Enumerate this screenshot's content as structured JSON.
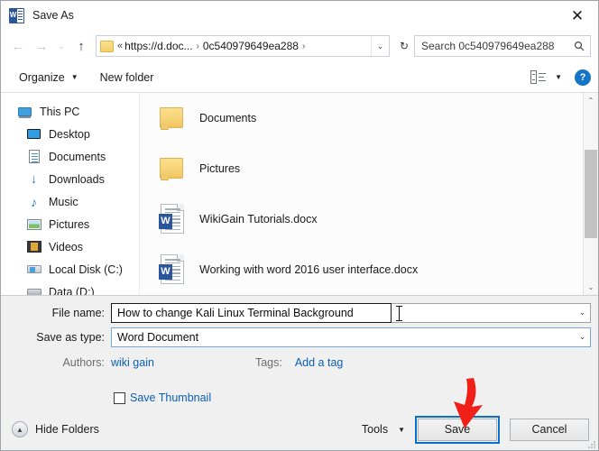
{
  "window": {
    "title": "Save As",
    "app_icon": "word-icon",
    "close_label": "✕"
  },
  "nav": {
    "back": "←",
    "forward": "→",
    "recent": "⌄",
    "up": "↑",
    "address": {
      "folder_icon": "folder-icon",
      "separator_double": "«",
      "crumbs": [
        "https://d.doc...",
        "0c540979649ea288"
      ],
      "chevron": "›",
      "dropdown": "⌄",
      "refresh": "↻"
    },
    "search": {
      "placeholder": "Search 0c540979649ea288",
      "value": "Search 0c540979649ea288",
      "icon": "search-icon"
    }
  },
  "toolbar": {
    "organize_label": "Organize",
    "organize_caret": "▼",
    "new_folder_label": "New folder",
    "view_icon": "view-layout-icon",
    "view_caret": "▼",
    "help_label": "?"
  },
  "sidebar": {
    "items": [
      {
        "label": "This PC",
        "icon": "this-pc-icon",
        "indent": false
      },
      {
        "label": "Desktop",
        "icon": "desktop-icon",
        "indent": true
      },
      {
        "label": "Documents",
        "icon": "documents-icon",
        "indent": true
      },
      {
        "label": "Downloads",
        "icon": "downloads-icon",
        "indent": true
      },
      {
        "label": "Music",
        "icon": "music-icon",
        "indent": true
      },
      {
        "label": "Pictures",
        "icon": "pictures-icon",
        "indent": true
      },
      {
        "label": "Videos",
        "icon": "videos-icon",
        "indent": true
      },
      {
        "label": "Local Disk (C:)",
        "icon": "local-disk-icon",
        "indent": true
      },
      {
        "label": "Data (D:)",
        "icon": "data-disk-icon",
        "indent": true
      }
    ]
  },
  "filelist": {
    "items": [
      {
        "name": "Documents",
        "type": "folder",
        "icon": "folder-icon"
      },
      {
        "name": "Pictures",
        "type": "folder",
        "icon": "folder-icon"
      },
      {
        "name": "WikiGain Tutorials.docx",
        "type": "docx",
        "icon": "word-document-icon"
      },
      {
        "name": "Working with word 2016 user interface.docx",
        "type": "docx",
        "icon": "word-document-icon"
      }
    ],
    "scrollbar": {
      "up_arrow": "⌃",
      "down_arrow": "⌄"
    }
  },
  "form": {
    "file_name_label": "File name:",
    "file_name_value": "How to change Kali Linux Terminal Background",
    "file_name_caret": "⌄",
    "save_as_type_label": "Save as type:",
    "save_as_type_value": "Word Document",
    "save_as_type_caret": "⌄",
    "authors_label": "Authors:",
    "authors_value": "wiki gain",
    "tags_label": "Tags:",
    "tags_value": "Add a tag",
    "save_thumbnail_label": "Save Thumbnail",
    "save_thumbnail_checked": false
  },
  "footer": {
    "hide_folders_label": "Hide Folders",
    "hide_folders_icon": "▲",
    "tools_label": "Tools",
    "tools_caret": "▼",
    "save_label": "Save",
    "cancel_label": "Cancel"
  },
  "annotation": {
    "arrow_color": "#f01f17",
    "points_to": "save-button"
  },
  "colors": {
    "accent": "#0b71c8",
    "link": "#0b5fb5",
    "word_blue": "#2b579a",
    "folder_yellow": "#f3cf6b",
    "annotation_red": "#f01f17"
  }
}
